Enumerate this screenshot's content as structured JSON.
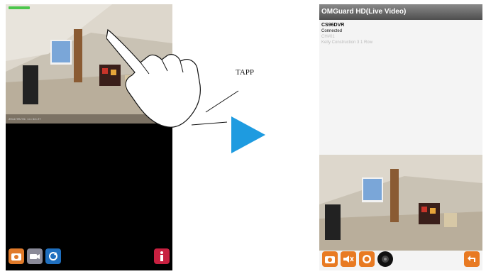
{
  "left_phone": {
    "timestamp": "2012/05/01 11:34:27",
    "toolbar": [
      "snapshot-icon",
      "record-icon",
      "refresh-icon",
      "info-icon"
    ]
  },
  "annotation": {
    "label": "TAPP"
  },
  "right_phone": {
    "title": "OMGuard HD(Live Video)",
    "device_name": "CS96DVR",
    "status": "Connected",
    "channel": "CH#01",
    "location": "Kelly Construction 3 1 Row",
    "toolbar": [
      "camera-icon",
      "mute-icon",
      "record-icon",
      "ptz-icon",
      "back-icon"
    ]
  },
  "colors": {
    "arrow": "#1e9be0",
    "accent_orange": "#e87a22",
    "info_red": "#c82040"
  }
}
